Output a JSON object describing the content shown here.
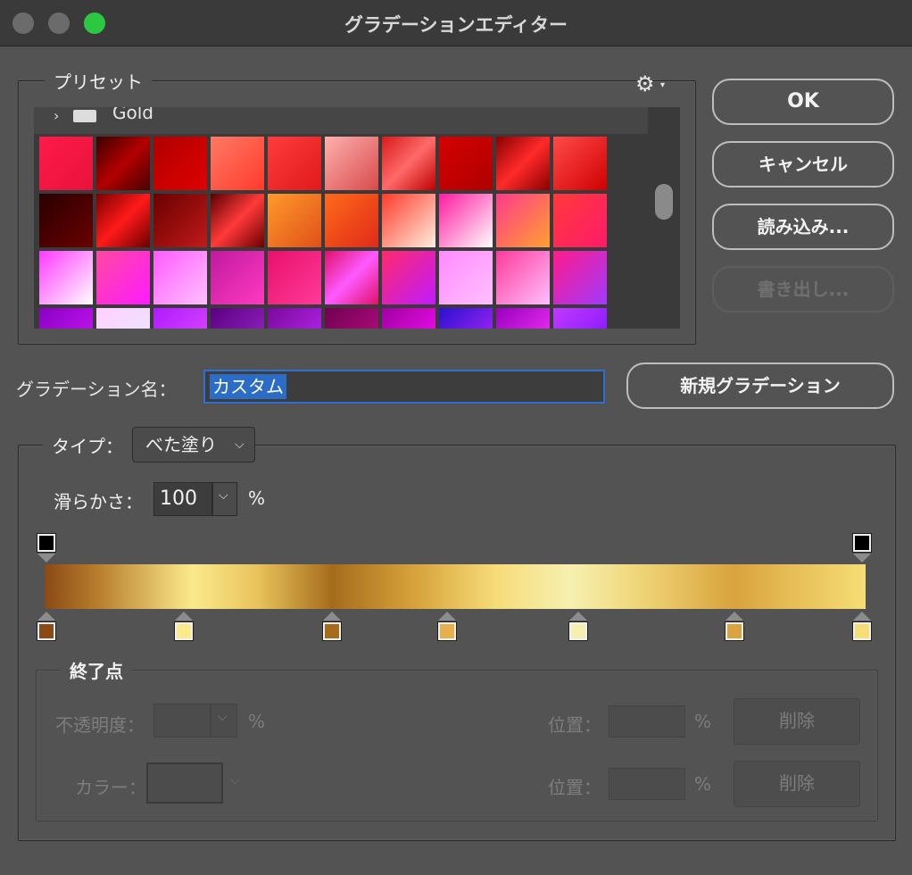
{
  "window": {
    "title": "グラデーションエディター"
  },
  "presets": {
    "label": "プリセット",
    "folder_name": "Gold",
    "swatch_rows": [
      [
        "linear-gradient(135deg,#ff1a4a,#e8123c)",
        "linear-gradient(135deg,#3a0000,#b20000 50%,#4a0000)",
        "linear-gradient(135deg,#b00000,#e00000)",
        "linear-gradient(135deg,#ff7a66,#ff3a2a)",
        "linear-gradient(135deg,#ff3b3b,#e01a1a)",
        "linear-gradient(135deg,#ffb0b0,#d84a4a)",
        "linear-gradient(135deg,#d81a1a,#ff6a6a 50%,#c00000)",
        "linear-gradient(135deg,#d40000,#b00000)",
        "linear-gradient(135deg,#8a0000,#ff2a2a 50%,#8a0000)",
        "linear-gradient(135deg,#ff4a4a,#d00000)"
      ],
      [
        "linear-gradient(135deg,#2a0000,#6a0000)",
        "linear-gradient(135deg,#7a0000,#ff1a1a 50%,#6a0000)",
        "linear-gradient(135deg,#6a0000,#c01a1a)",
        "linear-gradient(135deg,#5a0000,#ff3a3a 50%,#6a0000)",
        "linear-gradient(135deg,#ff9a2a,#e0501a)",
        "linear-gradient(135deg,#ff6a1a,#e02a1a)",
        "linear-gradient(135deg,#ff3a2a,#fff0e0)",
        "linear-gradient(135deg,#ff1aa0,#ffffff)",
        "linear-gradient(135deg,#ff3a8a,#ffa030)",
        "linear-gradient(135deg,#ff3a3a,#ff1a6a)"
      ],
      [
        "linear-gradient(135deg,#ff3aff,#ffffff)",
        "linear-gradient(135deg,#ff4aa0,#ff1aff)",
        "linear-gradient(135deg,#ff5aff,#ffc0ff)",
        "linear-gradient(135deg,#c01aa0,#ff3ac0)",
        "linear-gradient(135deg,#e8106a,#ff3a9a)",
        "linear-gradient(135deg,#e0106a,#ff5aff 50%,#e0106a)",
        "linear-gradient(135deg,#ff2a6a,#c01aff)",
        "linear-gradient(135deg,#ff8aff,#ffc0ff)",
        "linear-gradient(135deg,#ff3a9a,#ffc0ff)",
        "linear-gradient(135deg,#ff1a8a,#a03aff)"
      ],
      [
        "linear-gradient(135deg,#8a00c0,#d01aff)",
        "linear-gradient(135deg,#ffd0ff,#e8e8ff)",
        "linear-gradient(135deg,#b01aff,#e050ff)",
        "linear-gradient(135deg,#5a0080,#a02ad0)",
        "linear-gradient(135deg,#7a0a9a,#c02aff)",
        "linear-gradient(135deg,#700050,#c0108a)",
        "linear-gradient(135deg,#a000a0,#ff10ff)",
        "linear-gradient(135deg,#2a10d0,#c02aff)",
        "linear-gradient(135deg,#9a00c0,#ff3aff)",
        "linear-gradient(135deg,#c03aff,#7a10ff)"
      ]
    ]
  },
  "buttons": {
    "ok": "OK",
    "cancel": "キャンセル",
    "load": "読み込み...",
    "save": "書き出し...",
    "new_gradient": "新規グラデーション"
  },
  "gradient_name": {
    "label": "グラデーション名：",
    "value": "カスタム"
  },
  "gradient_type": {
    "label": "タイプ：",
    "value": "べた塗り"
  },
  "smoothness": {
    "label": "滑らかさ：",
    "value": "100",
    "unit": "%"
  },
  "opacity_stops": [
    {
      "location": 0,
      "color": "#000000"
    },
    {
      "location": 100,
      "color": "#000000"
    }
  ],
  "color_stops": [
    {
      "location": 0,
      "color": "#8a4a16"
    },
    {
      "location": 17,
      "color": "#fbea8c"
    },
    {
      "location": 35,
      "color": "#a56c1c"
    },
    {
      "location": 49,
      "color": "#e8b04a"
    },
    {
      "location": 65,
      "color": "#f6f0b0"
    },
    {
      "location": 84,
      "color": "#d9a33d"
    },
    {
      "location": 100,
      "color": "#f6de76"
    }
  ],
  "stops_panel": {
    "label": "終了点",
    "opacity_label": "不透明度：",
    "opacity_unit": "%",
    "color_label": "カラー：",
    "location_label": "位置：",
    "location_unit": "%",
    "delete_label": "削除"
  }
}
